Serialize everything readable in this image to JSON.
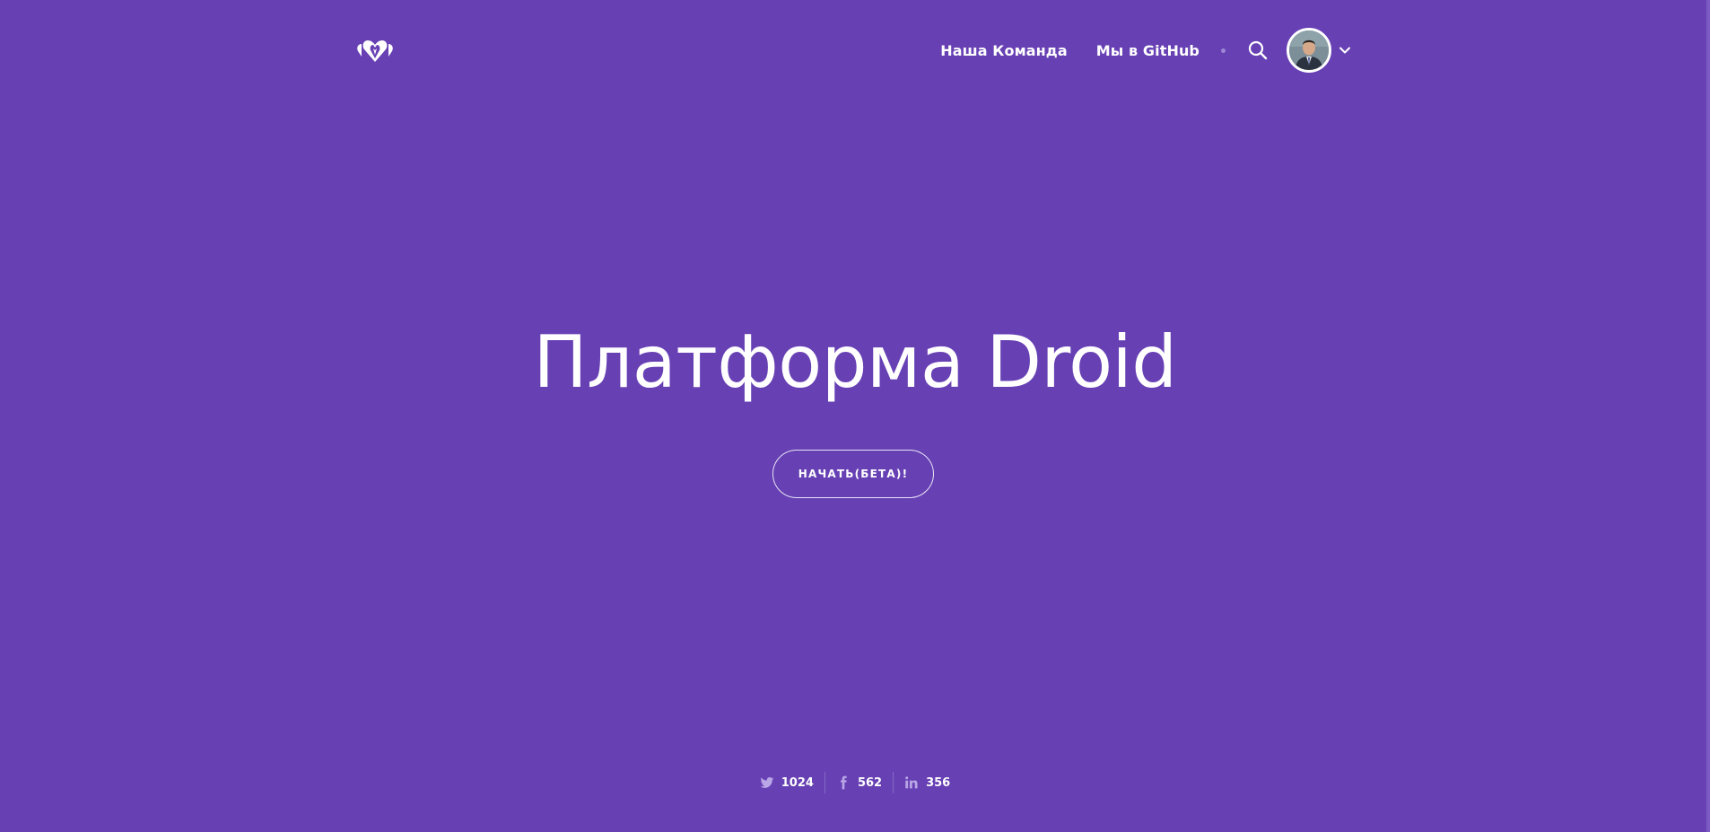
{
  "header": {
    "logo_icon": "hearts-logo-icon",
    "nav": {
      "team_label": "Наша Команда",
      "github_label": "Мы в GitHub"
    },
    "search_icon": "search-icon",
    "avatar_icon": "user-avatar",
    "dropdown_icon": "chevron-down-icon"
  },
  "hero": {
    "title": "Платформа Droid",
    "cta_label": "НАЧАТЬ(БЕТА)!"
  },
  "social": [
    {
      "icon": "twitter-icon",
      "count": "1024"
    },
    {
      "icon": "facebook-icon",
      "count": "562"
    },
    {
      "icon": "linkedin-icon",
      "count": "356"
    }
  ],
  "colors": {
    "background": "#6740b4",
    "text": "#ffffff",
    "muted": "#9e87d4"
  }
}
